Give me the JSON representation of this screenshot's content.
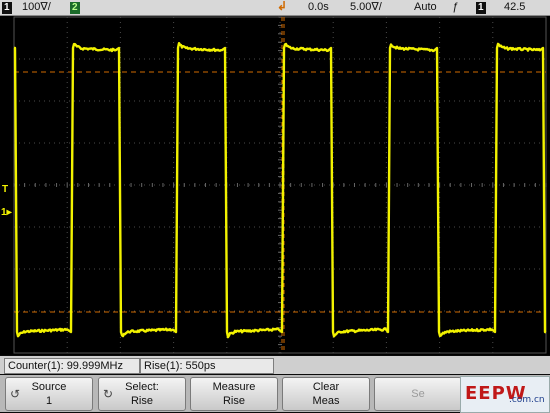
{
  "status": {
    "ch1_number": "1",
    "ch1_scale": "100∇/",
    "ch2_number": "2",
    "time_position": "0.0s",
    "time_scale": "5.00∇/",
    "trigger_mode": "Auto",
    "trigger_slope_icon": "rising-edge",
    "trigger_source": "1",
    "trigger_level": "42.5"
  },
  "markers": {
    "ground_label": "1",
    "trigger_label": "T"
  },
  "colors": {
    "trace": "#f2f200",
    "cursor": "#d06a00",
    "grid": "#4a4a4a"
  },
  "measurements": {
    "counter": "Counter(1): 99.999MHz",
    "rise": "Rise(1): 550ps"
  },
  "softkeys": [
    {
      "line1": "Source",
      "line2": "1",
      "icon": "return-icon"
    },
    {
      "line1": "Select:",
      "line2": "Rise",
      "icon": "rotate-knob-icon"
    },
    {
      "line1": "Measure",
      "line2": "Rise",
      "icon": ""
    },
    {
      "line1": "Clear",
      "line2": "Meas",
      "icon": ""
    },
    {
      "line1": "Se",
      "line2": "",
      "icon": ""
    }
  ],
  "watermark": {
    "logo": "EEPW",
    "site": ".com.cn"
  }
}
